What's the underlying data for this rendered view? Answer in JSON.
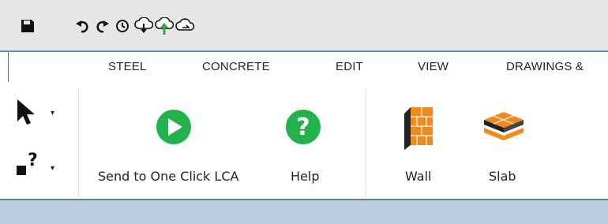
{
  "quick_access": {
    "icons": [
      "save-icon",
      "undo-icon",
      "redo-icon",
      "history-icon",
      "cloud-download-icon",
      "cloud-upload-icon",
      "cloud-sync-icon"
    ]
  },
  "tabs": [
    {
      "label": "STEEL"
    },
    {
      "label": "CONCRETE"
    },
    {
      "label": "EDIT"
    },
    {
      "label": "VIEW"
    },
    {
      "label": "DRAWINGS &"
    }
  ],
  "ribbon": {
    "select_dropdown": "▾",
    "help_dropdown": "▾",
    "send_label": "Send to One Click LCA",
    "help_label": "Help",
    "wall_label": "Wall",
    "slab_label": "Slab"
  },
  "colors": {
    "accent_blue": "#5b8fc7",
    "play_green": "#21b24b",
    "wall_orange": "#f08a1c",
    "cloud_up_green": "#3aa83a"
  }
}
